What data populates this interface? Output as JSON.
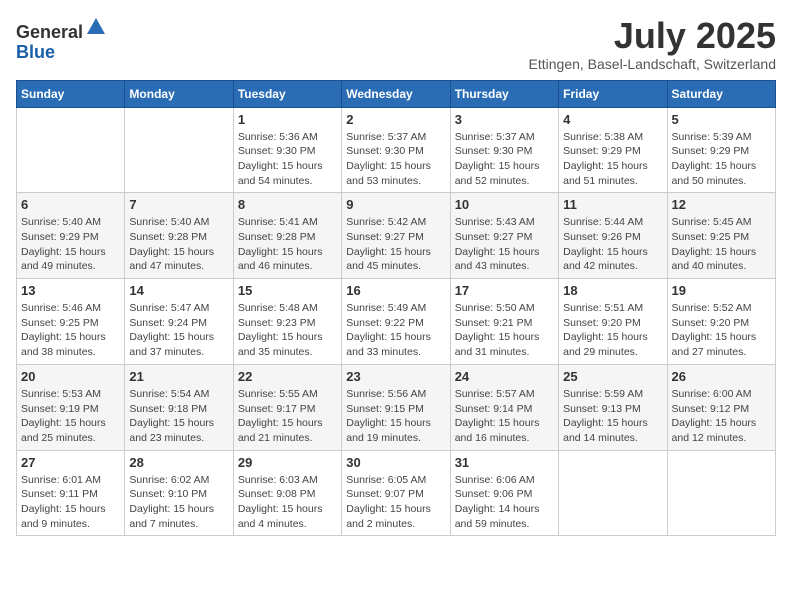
{
  "logo": {
    "general": "General",
    "blue": "Blue"
  },
  "header": {
    "month_year": "July 2025",
    "location": "Ettingen, Basel-Landschaft, Switzerland"
  },
  "weekdays": [
    "Sunday",
    "Monday",
    "Tuesday",
    "Wednesday",
    "Thursday",
    "Friday",
    "Saturday"
  ],
  "weeks": [
    [
      {
        "day": "",
        "info": ""
      },
      {
        "day": "",
        "info": ""
      },
      {
        "day": "1",
        "info": "Sunrise: 5:36 AM\nSunset: 9:30 PM\nDaylight: 15 hours\nand 54 minutes."
      },
      {
        "day": "2",
        "info": "Sunrise: 5:37 AM\nSunset: 9:30 PM\nDaylight: 15 hours\nand 53 minutes."
      },
      {
        "day": "3",
        "info": "Sunrise: 5:37 AM\nSunset: 9:30 PM\nDaylight: 15 hours\nand 52 minutes."
      },
      {
        "day": "4",
        "info": "Sunrise: 5:38 AM\nSunset: 9:29 PM\nDaylight: 15 hours\nand 51 minutes."
      },
      {
        "day": "5",
        "info": "Sunrise: 5:39 AM\nSunset: 9:29 PM\nDaylight: 15 hours\nand 50 minutes."
      }
    ],
    [
      {
        "day": "6",
        "info": "Sunrise: 5:40 AM\nSunset: 9:29 PM\nDaylight: 15 hours\nand 49 minutes."
      },
      {
        "day": "7",
        "info": "Sunrise: 5:40 AM\nSunset: 9:28 PM\nDaylight: 15 hours\nand 47 minutes."
      },
      {
        "day": "8",
        "info": "Sunrise: 5:41 AM\nSunset: 9:28 PM\nDaylight: 15 hours\nand 46 minutes."
      },
      {
        "day": "9",
        "info": "Sunrise: 5:42 AM\nSunset: 9:27 PM\nDaylight: 15 hours\nand 45 minutes."
      },
      {
        "day": "10",
        "info": "Sunrise: 5:43 AM\nSunset: 9:27 PM\nDaylight: 15 hours\nand 43 minutes."
      },
      {
        "day": "11",
        "info": "Sunrise: 5:44 AM\nSunset: 9:26 PM\nDaylight: 15 hours\nand 42 minutes."
      },
      {
        "day": "12",
        "info": "Sunrise: 5:45 AM\nSunset: 9:25 PM\nDaylight: 15 hours\nand 40 minutes."
      }
    ],
    [
      {
        "day": "13",
        "info": "Sunrise: 5:46 AM\nSunset: 9:25 PM\nDaylight: 15 hours\nand 38 minutes."
      },
      {
        "day": "14",
        "info": "Sunrise: 5:47 AM\nSunset: 9:24 PM\nDaylight: 15 hours\nand 37 minutes."
      },
      {
        "day": "15",
        "info": "Sunrise: 5:48 AM\nSunset: 9:23 PM\nDaylight: 15 hours\nand 35 minutes."
      },
      {
        "day": "16",
        "info": "Sunrise: 5:49 AM\nSunset: 9:22 PM\nDaylight: 15 hours\nand 33 minutes."
      },
      {
        "day": "17",
        "info": "Sunrise: 5:50 AM\nSunset: 9:21 PM\nDaylight: 15 hours\nand 31 minutes."
      },
      {
        "day": "18",
        "info": "Sunrise: 5:51 AM\nSunset: 9:20 PM\nDaylight: 15 hours\nand 29 minutes."
      },
      {
        "day": "19",
        "info": "Sunrise: 5:52 AM\nSunset: 9:20 PM\nDaylight: 15 hours\nand 27 minutes."
      }
    ],
    [
      {
        "day": "20",
        "info": "Sunrise: 5:53 AM\nSunset: 9:19 PM\nDaylight: 15 hours\nand 25 minutes."
      },
      {
        "day": "21",
        "info": "Sunrise: 5:54 AM\nSunset: 9:18 PM\nDaylight: 15 hours\nand 23 minutes."
      },
      {
        "day": "22",
        "info": "Sunrise: 5:55 AM\nSunset: 9:17 PM\nDaylight: 15 hours\nand 21 minutes."
      },
      {
        "day": "23",
        "info": "Sunrise: 5:56 AM\nSunset: 9:15 PM\nDaylight: 15 hours\nand 19 minutes."
      },
      {
        "day": "24",
        "info": "Sunrise: 5:57 AM\nSunset: 9:14 PM\nDaylight: 15 hours\nand 16 minutes."
      },
      {
        "day": "25",
        "info": "Sunrise: 5:59 AM\nSunset: 9:13 PM\nDaylight: 15 hours\nand 14 minutes."
      },
      {
        "day": "26",
        "info": "Sunrise: 6:00 AM\nSunset: 9:12 PM\nDaylight: 15 hours\nand 12 minutes."
      }
    ],
    [
      {
        "day": "27",
        "info": "Sunrise: 6:01 AM\nSunset: 9:11 PM\nDaylight: 15 hours\nand 9 minutes."
      },
      {
        "day": "28",
        "info": "Sunrise: 6:02 AM\nSunset: 9:10 PM\nDaylight: 15 hours\nand 7 minutes."
      },
      {
        "day": "29",
        "info": "Sunrise: 6:03 AM\nSunset: 9:08 PM\nDaylight: 15 hours\nand 4 minutes."
      },
      {
        "day": "30",
        "info": "Sunrise: 6:05 AM\nSunset: 9:07 PM\nDaylight: 15 hours\nand 2 minutes."
      },
      {
        "day": "31",
        "info": "Sunrise: 6:06 AM\nSunset: 9:06 PM\nDaylight: 14 hours\nand 59 minutes."
      },
      {
        "day": "",
        "info": ""
      },
      {
        "day": "",
        "info": ""
      }
    ]
  ]
}
